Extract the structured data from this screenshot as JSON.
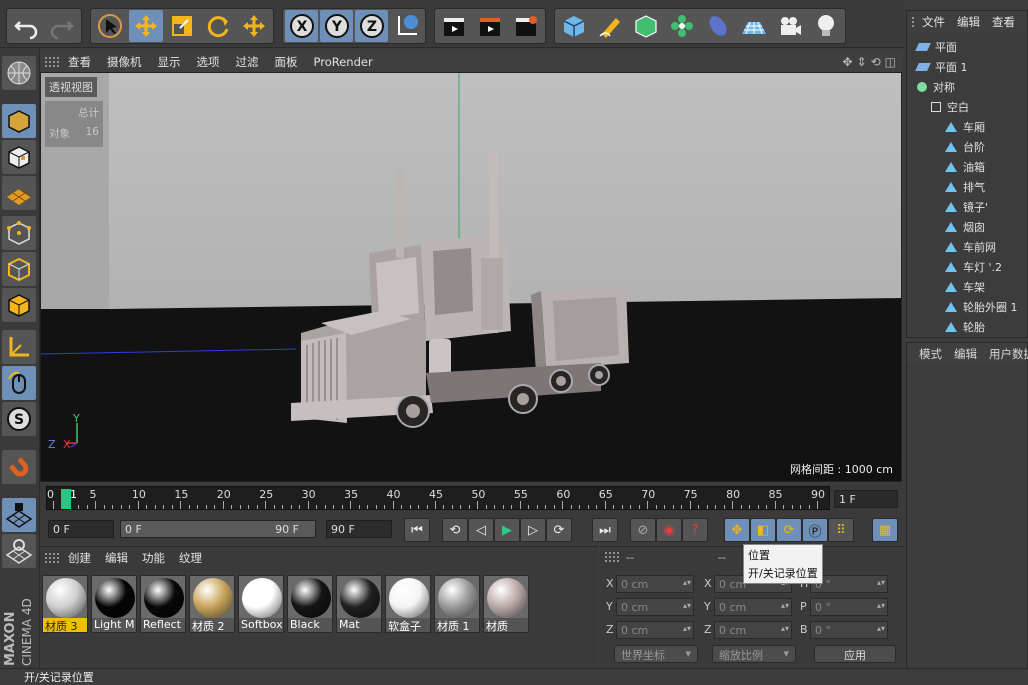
{
  "app": {
    "name": "CINEMA 4D",
    "vendor": "MAXON"
  },
  "viewport_menu": [
    "查看",
    "摄像机",
    "显示",
    "选项",
    "过滤",
    "面板",
    "ProRender"
  ],
  "viewport": {
    "label": "透视视图",
    "stats": {
      "title": "总计",
      "objects_label": "对象",
      "objects_value": "16"
    },
    "grid_spacing": "网格间距 : 1000 cm",
    "axis_y": "Y",
    "axis_z": "Z",
    "axis_x": "X"
  },
  "timeline": {
    "ticks": [
      "0",
      "5",
      "10",
      "15",
      "20",
      "25",
      "30",
      "35",
      "40",
      "45",
      "50",
      "55",
      "60",
      "65",
      "70",
      "75",
      "80",
      "85",
      "90"
    ],
    "current_marker": "1",
    "end_frame": "1 F"
  },
  "transport": {
    "current_frame": "0 F",
    "range_start": "0 F",
    "range_end": "90 F",
    "max_frame": "90 F"
  },
  "material_menu": [
    "创建",
    "编辑",
    "功能",
    "纹理"
  ],
  "materials": [
    {
      "name": "材质 3",
      "color": "#cfcfcf",
      "selected": true
    },
    {
      "name": "Light M",
      "color": "#050505",
      "selected": false
    },
    {
      "name": "Reflect",
      "color": "#080808",
      "selected": false
    },
    {
      "name": "材质 2",
      "color": "#c9a55c",
      "selected": false
    },
    {
      "name": "Softbox",
      "color": "#ffffff",
      "selected": false
    },
    {
      "name": "Black",
      "color": "#151515",
      "selected": false
    },
    {
      "name": "Mat",
      "color": "#202020",
      "selected": false
    },
    {
      "name": "软盒子",
      "color": "#f4f4f4",
      "selected": false
    },
    {
      "name": "材质 1",
      "color": "#9a9a9a",
      "selected": false
    },
    {
      "name": "材质",
      "color": "#b9aaa8",
      "selected": false
    }
  ],
  "coordinates": {
    "header_left": "--",
    "header_mid": "--",
    "rows": [
      {
        "pos_axis": "X",
        "pos_value": "0 cm",
        "size_axis": "X",
        "size_value": "0 cm",
        "rot_axis": "H",
        "rot_value": "0 °"
      },
      {
        "pos_axis": "Y",
        "pos_value": "0 cm",
        "size_axis": "Y",
        "size_value": "0 cm",
        "rot_axis": "P",
        "rot_value": "0 °"
      },
      {
        "pos_axis": "Z",
        "pos_value": "0 cm",
        "size_axis": "Z",
        "size_value": "0 cm",
        "rot_axis": "B",
        "rot_value": "0 °"
      }
    ],
    "world_select": "世界坐标",
    "scale_select": "缩放比例",
    "apply_button": "应用"
  },
  "tooltip": {
    "title": "位置",
    "desc": "开/关记录位置"
  },
  "object_menu": [
    "文件",
    "编辑",
    "查看"
  ],
  "objects": [
    {
      "name": "平面",
      "type": "plane",
      "indent": 0
    },
    {
      "name": "平面 1",
      "type": "plane",
      "indent": 0
    },
    {
      "name": "对称",
      "type": "symmetry",
      "indent": 0
    },
    {
      "name": "空白",
      "type": "null",
      "indent": 1
    },
    {
      "name": "车厢",
      "type": "poly",
      "indent": 2
    },
    {
      "name": "台阶",
      "type": "poly",
      "indent": 2
    },
    {
      "name": "油箱",
      "type": "poly",
      "indent": 2
    },
    {
      "name": "排气",
      "type": "poly",
      "indent": 2
    },
    {
      "name": "镜子'",
      "type": "poly",
      "indent": 2
    },
    {
      "name": "烟囱",
      "type": "poly",
      "indent": 2
    },
    {
      "name": "车前网",
      "type": "poly",
      "indent": 2
    },
    {
      "name": "车灯 '.2",
      "type": "poly",
      "indent": 2
    },
    {
      "name": "车架",
      "type": "poly",
      "indent": 2
    },
    {
      "name": "轮胎外圈 1",
      "type": "poly",
      "indent": 2
    },
    {
      "name": "轮胎",
      "type": "poly",
      "indent": 2
    }
  ],
  "attribute_menu": [
    "模式",
    "编辑",
    "用户数据"
  ],
  "status": "开/关记录位置",
  "colors": {
    "accent_blue": "#6e8fb8",
    "selected_material": "#f0c000",
    "playhead": "#29c48a"
  }
}
